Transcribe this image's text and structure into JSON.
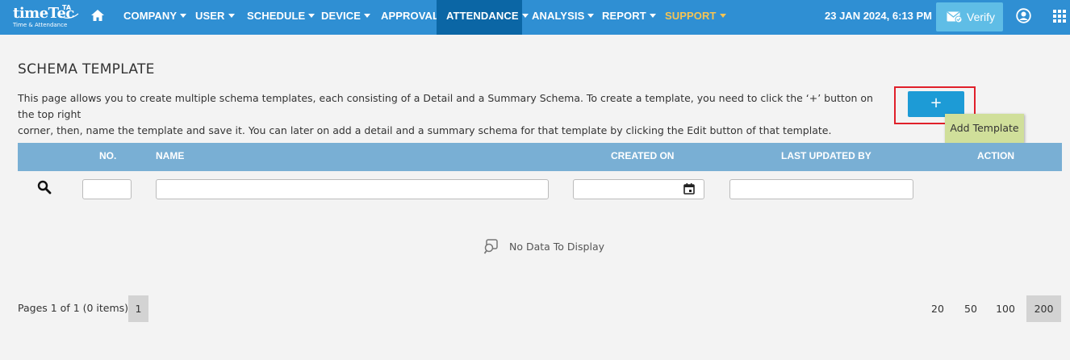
{
  "logo": {
    "main": "timeTec",
    "superscript": "TA",
    "subtitle": "Time & Attendance"
  },
  "nav": {
    "items": [
      {
        "label": "COMPANY",
        "dropdown": true
      },
      {
        "label": "USER",
        "dropdown": true
      },
      {
        "label": "SCHEDULE",
        "dropdown": true
      },
      {
        "label": "DEVICE",
        "dropdown": true
      },
      {
        "label": "APPROVAL",
        "dropdown": false
      },
      {
        "label": "ATTENDANCE",
        "dropdown": true,
        "active": true
      },
      {
        "label": "ANALYSIS",
        "dropdown": true
      },
      {
        "label": "REPORT",
        "dropdown": true
      },
      {
        "label": "SUPPORT",
        "dropdown": true
      }
    ],
    "datetime": "23 JAN 2024, 6:13 PM",
    "verify_label": "Verify",
    "icons": [
      "home-icon",
      "mail-check-icon",
      "user-circle-icon",
      "apps-grid-icon"
    ]
  },
  "page": {
    "title": "SCHEMA TEMPLATE",
    "description_line1": "This page allows you to create multiple schema templates, each consisting of a Detail and a Summary Schema. To create a template, you need to click the ‘+’ button on the top right",
    "description_line2": "corner, then, name the template and save it. You can later on add a detail and a summary schema for that template by clicking the Edit button of that template.",
    "add_button_label": "+",
    "add_tooltip": "Add Template"
  },
  "table": {
    "columns": [
      "NO.",
      "NAME",
      "CREATED ON",
      "LAST UPDATED BY",
      "ACTION"
    ],
    "filters": {
      "no": "",
      "name": "",
      "created_on": "",
      "last_updated_by": ""
    },
    "empty_message": "No Data To Display"
  },
  "pager": {
    "info": "Pages 1 of 1 (0 items)",
    "current_page": "1",
    "page_sizes": [
      "20",
      "50",
      "100",
      "200"
    ],
    "selected_page_size": "200"
  },
  "colors": {
    "topbar": "#2f8fd3",
    "active_nav": "#0b66a5",
    "support": "#f6c453",
    "table_header": "#79afd4",
    "add_button": "#1d9bd6",
    "highlight": "#e0202a",
    "tooltip": "#d0df9a"
  }
}
